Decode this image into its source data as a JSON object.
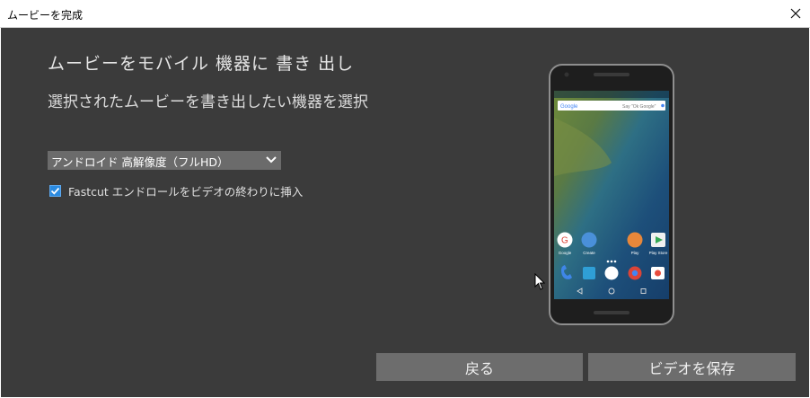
{
  "window": {
    "title": "ムービーを完成"
  },
  "main": {
    "heading": "ムービーをモバイル 機器に 書き 出し",
    "subheading": "選択されたムービーを書き出したい機器を選択"
  },
  "device_select": {
    "value": "アンドロイド 高解像度（フルHD）"
  },
  "endroll_checkbox": {
    "label": "Fastcut エンドロールをビデオの終わりに挿入",
    "checked": true
  },
  "phone_preview": {
    "search_brand": "Google",
    "search_hint": "Say \"Ok Google\"",
    "apps": [
      {
        "label": "Google"
      },
      {
        "label": "Create"
      },
      {
        "label": "Play"
      },
      {
        "label": "Play Store"
      }
    ]
  },
  "buttons": {
    "back": "戻る",
    "save": "ビデオを保存"
  },
  "colors": {
    "background": "#3b3b3b",
    "button": "#6d6d6d",
    "checkbox": "#2a8ae0"
  }
}
